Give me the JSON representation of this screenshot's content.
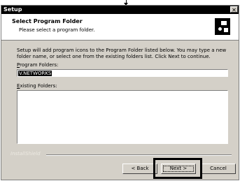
{
  "window": {
    "title": "Setup",
    "close_glyph": "✕"
  },
  "header": {
    "title": "Select Program Folder",
    "subtitle": "Please select a program folder.",
    "icon": "setup-icon"
  },
  "body": {
    "instructions": "Setup will add program icons to the Program Folder listed below.  You may type a new folder name, or select one from the existing folders list.  Click Next to continue."
  },
  "program_folders": {
    "label": "Program Folders:",
    "value": "V.NETWORKS"
  },
  "existing_folders": {
    "label": "Existing Folders:",
    "items": []
  },
  "footer": {
    "brand": "InstallShield",
    "back_label": "< Back",
    "next_label": "Next >",
    "cancel_label": "Cancel"
  }
}
